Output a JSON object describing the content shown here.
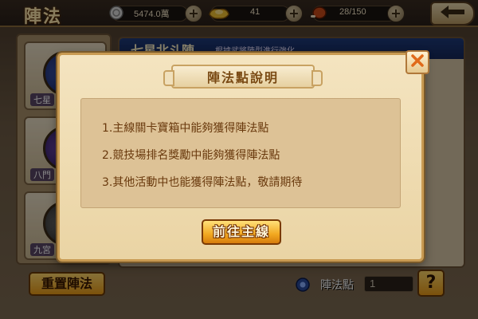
{
  "header": {
    "title": "陣法",
    "silver": {
      "icon": "silver-coin-icon",
      "value": "5474.0萬"
    },
    "gold": {
      "icon": "gold-ingot-icon",
      "value": "41"
    },
    "stamina": {
      "icon": "meat-stamina-icon",
      "value": "28/150"
    },
    "plus_label": "+",
    "back_icon": "back-arrow-icon"
  },
  "formations": [
    {
      "name": "七星",
      "color": "#2a3f8a"
    },
    {
      "name": "八門",
      "color": "#4a2a7a"
    },
    {
      "name": "九宮",
      "color": "#3a3a3a"
    }
  ],
  "formation_panel": {
    "title": "七星北斗陣",
    "hint": "根據武將陣型進行強化"
  },
  "footer": {
    "reset_label": "重置陣法",
    "points_label": "陣法點",
    "points_value": "1",
    "help_label": "?"
  },
  "modal": {
    "title": "陣法點說明",
    "rules": [
      "1.主線關卡寶箱中能夠獲得陣法點",
      "2.競技場排名獎勵中能夠獲得陣法點",
      "3.其他活動中也能獲得陣法點，敬請期待"
    ],
    "go_label": "前往主線",
    "close_icon": "close-x-icon"
  },
  "colors": {
    "modal_bg": "#f4e4c0",
    "rule_text": "#6a3a0e",
    "button_gold": "#f2a820",
    "close_x": "#e06a1a"
  }
}
